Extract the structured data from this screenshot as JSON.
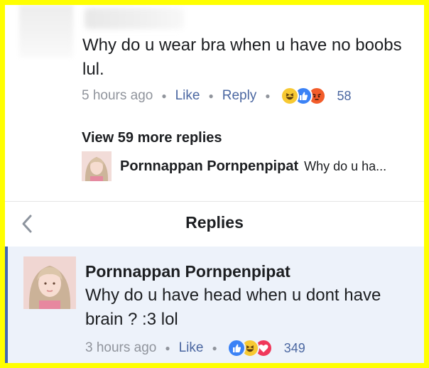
{
  "comment": {
    "text": "Why do u wear bra when u have no boobs lul.",
    "time": "5 hours ago",
    "like_label": "Like",
    "reply_label": "Reply",
    "reactions": [
      "haha-icon",
      "like-icon",
      "angry-icon"
    ],
    "reaction_count": "58"
  },
  "thread": {
    "view_more": "View 59 more replies",
    "preview_name": "Pornnappan Pornpenpipat",
    "preview_text": "Why do u ha..."
  },
  "replies_header": {
    "title": "Replies",
    "back_icon": "chevron-left-icon"
  },
  "reply": {
    "name": "Pornnappan Pornpenpipat",
    "text": "Why do u have head when u dont have brain ? :3 lol",
    "time": "3 hours ago",
    "like_label": "Like",
    "reactions": [
      "like-icon",
      "haha-icon",
      "love-icon"
    ],
    "reaction_count": "349"
  },
  "colors": {
    "frame": "#ffff00",
    "link": "#4b67a1",
    "meta": "#90949c",
    "highlight": "#edf2fa",
    "accent_bar": "#4267b2"
  }
}
